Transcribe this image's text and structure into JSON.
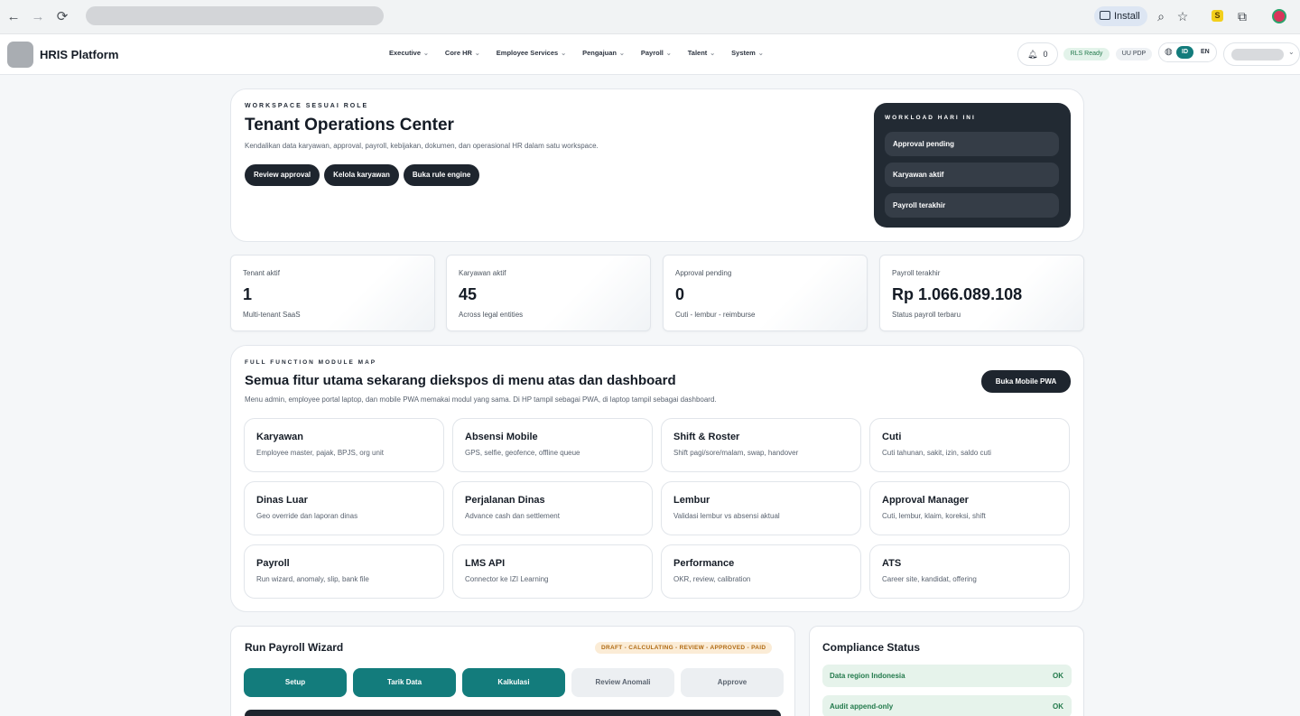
{
  "browser": {
    "install_label": "Install"
  },
  "header": {
    "brand": "HRIS Platform",
    "nav": [
      "Executive",
      "Core HR",
      "Employee Services",
      "Pengajuan",
      "Payroll",
      "Talent",
      "System"
    ],
    "notification_count": "0",
    "badge_rls": "RLS Ready",
    "badge_pdp": "UU PDP",
    "lang_active": "ID",
    "lang_other": "EN"
  },
  "hero": {
    "eyebrow": "WORKSPACE SESUAI ROLE",
    "title": "Tenant Operations Center",
    "description": "Kendalikan data karyawan, approval, payroll, kebijakan, dokumen, dan operasional HR dalam satu workspace.",
    "buttons": [
      "Review approval",
      "Kelola karyawan",
      "Buka rule engine"
    ],
    "workload": {
      "eyebrow": "WORKLOAD HARI INI",
      "items": [
        "Approval pending",
        "Karyawan aktif",
        "Payroll terakhir"
      ]
    }
  },
  "stats": [
    {
      "label": "Tenant aktif",
      "value": "1",
      "sub": "Multi-tenant SaaS"
    },
    {
      "label": "Karyawan aktif",
      "value": "45",
      "sub": "Across legal entities"
    },
    {
      "label": "Approval pending",
      "value": "0",
      "sub": "Cuti - lembur - reimburse"
    },
    {
      "label": "Payroll terakhir",
      "value": "Rp 1.066.089.108",
      "sub": "Status payroll terbaru"
    }
  ],
  "module_map": {
    "eyebrow": "FULL FUNCTION MODULE MAP",
    "title": "Semua fitur utama sekarang diekspos di menu atas dan dashboard",
    "description": "Menu admin, employee portal laptop, dan mobile PWA memakai modul yang sama. Di HP tampil sebagai PWA, di laptop tampil sebagai dashboard.",
    "pwa_button": "Buka Mobile PWA",
    "modules": [
      {
        "title": "Karyawan",
        "sub": "Employee master, pajak, BPJS, org unit"
      },
      {
        "title": "Absensi Mobile",
        "sub": "GPS, selfie, geofence, offline queue"
      },
      {
        "title": "Shift & Roster",
        "sub": "Shift pagi/sore/malam, swap, handover"
      },
      {
        "title": "Cuti",
        "sub": "Cuti tahunan, sakit, izin, saldo cuti"
      },
      {
        "title": "Dinas Luar",
        "sub": "Geo override dan laporan dinas"
      },
      {
        "title": "Perjalanan Dinas",
        "sub": "Advance cash dan settlement"
      },
      {
        "title": "Lembur",
        "sub": "Validasi lembur vs absensi aktual"
      },
      {
        "title": "Approval Manager",
        "sub": "Cuti, lembur, klaim, koreksi, shift"
      },
      {
        "title": "Payroll",
        "sub": "Run wizard, anomaly, slip, bank file"
      },
      {
        "title": "LMS API",
        "sub": "Connector ke IZI Learning"
      },
      {
        "title": "Performance",
        "sub": "OKR, review, calibration"
      },
      {
        "title": "ATS",
        "sub": "Career site, kandidat, offering"
      }
    ]
  },
  "wizard": {
    "title": "Run Payroll Wizard",
    "flow": "DRAFT - CALCULATING - REVIEW - APPROVED - PAID",
    "steps": [
      "Setup",
      "Tarik Data",
      "Kalkulasi",
      "Review Anomali",
      "Approve"
    ]
  },
  "compliance": {
    "title": "Compliance Status",
    "rows": [
      {
        "label": "Data region Indonesia",
        "status": "OK"
      },
      {
        "label": "Audit append-only",
        "status": "OK"
      }
    ]
  },
  "colors": {
    "accent_teal": "#137c7c",
    "dark": "#1e252e",
    "ok_green": "#237a4c"
  }
}
